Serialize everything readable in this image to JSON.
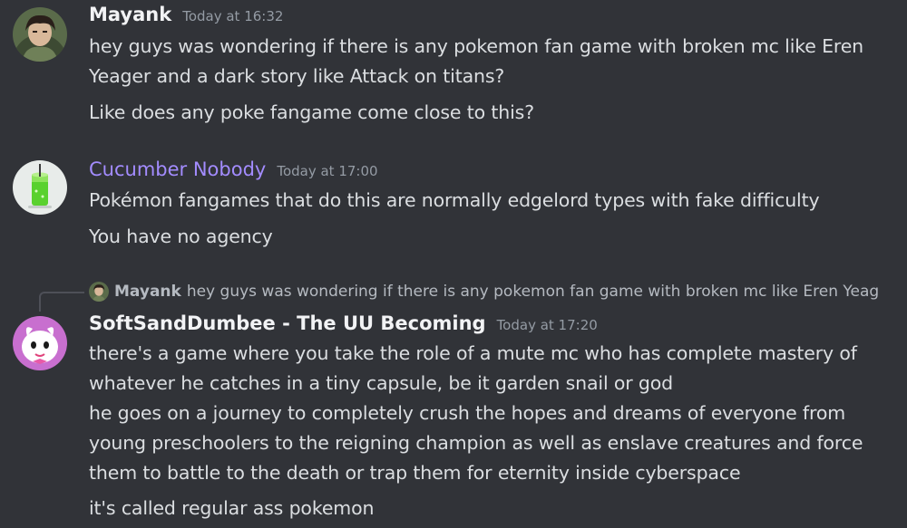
{
  "messages": [
    {
      "username": "Mayank",
      "timestamp": "Today at 16:32",
      "lines": [
        "hey guys was wondering if there is any pokemon fan game with broken mc like Eren",
        "Yeager and a dark story like Attack on titans?",
        "Like does any poke fangame come close to this?"
      ]
    },
    {
      "username": "Cucumber Nobody",
      "timestamp": "Today at 17:00",
      "lines": [
        "Pokémon fangames that do this are normally edgelord types with fake difficulty",
        "You have no agency"
      ]
    },
    {
      "reply": {
        "username": "Mayank",
        "text": "hey guys was wondering if there is any pokemon fan game with broken mc like Eren Yeag"
      },
      "username": "SoftSandDumbee - The UU Becoming",
      "timestamp": "Today at 17:20",
      "lines": [
        "there's a game where you take the role of a mute mc who has complete mastery of",
        "whatever he catches in a tiny capsule, be it garden snail or god",
        "he goes on a journey to completely crush the hopes and dreams of everyone from",
        "young preschoolers to the reigning champion as well as enslave creatures and force",
        "them to battle to the death or trap them for eternity inside cyberspace",
        "it's called regular ass pokemon"
      ]
    }
  ],
  "colors": {
    "background": "#313338",
    "username_default": "#f2f3f5",
    "username_role": "#a38cff",
    "timestamp": "#949ba4",
    "text": "#dbdee1"
  }
}
